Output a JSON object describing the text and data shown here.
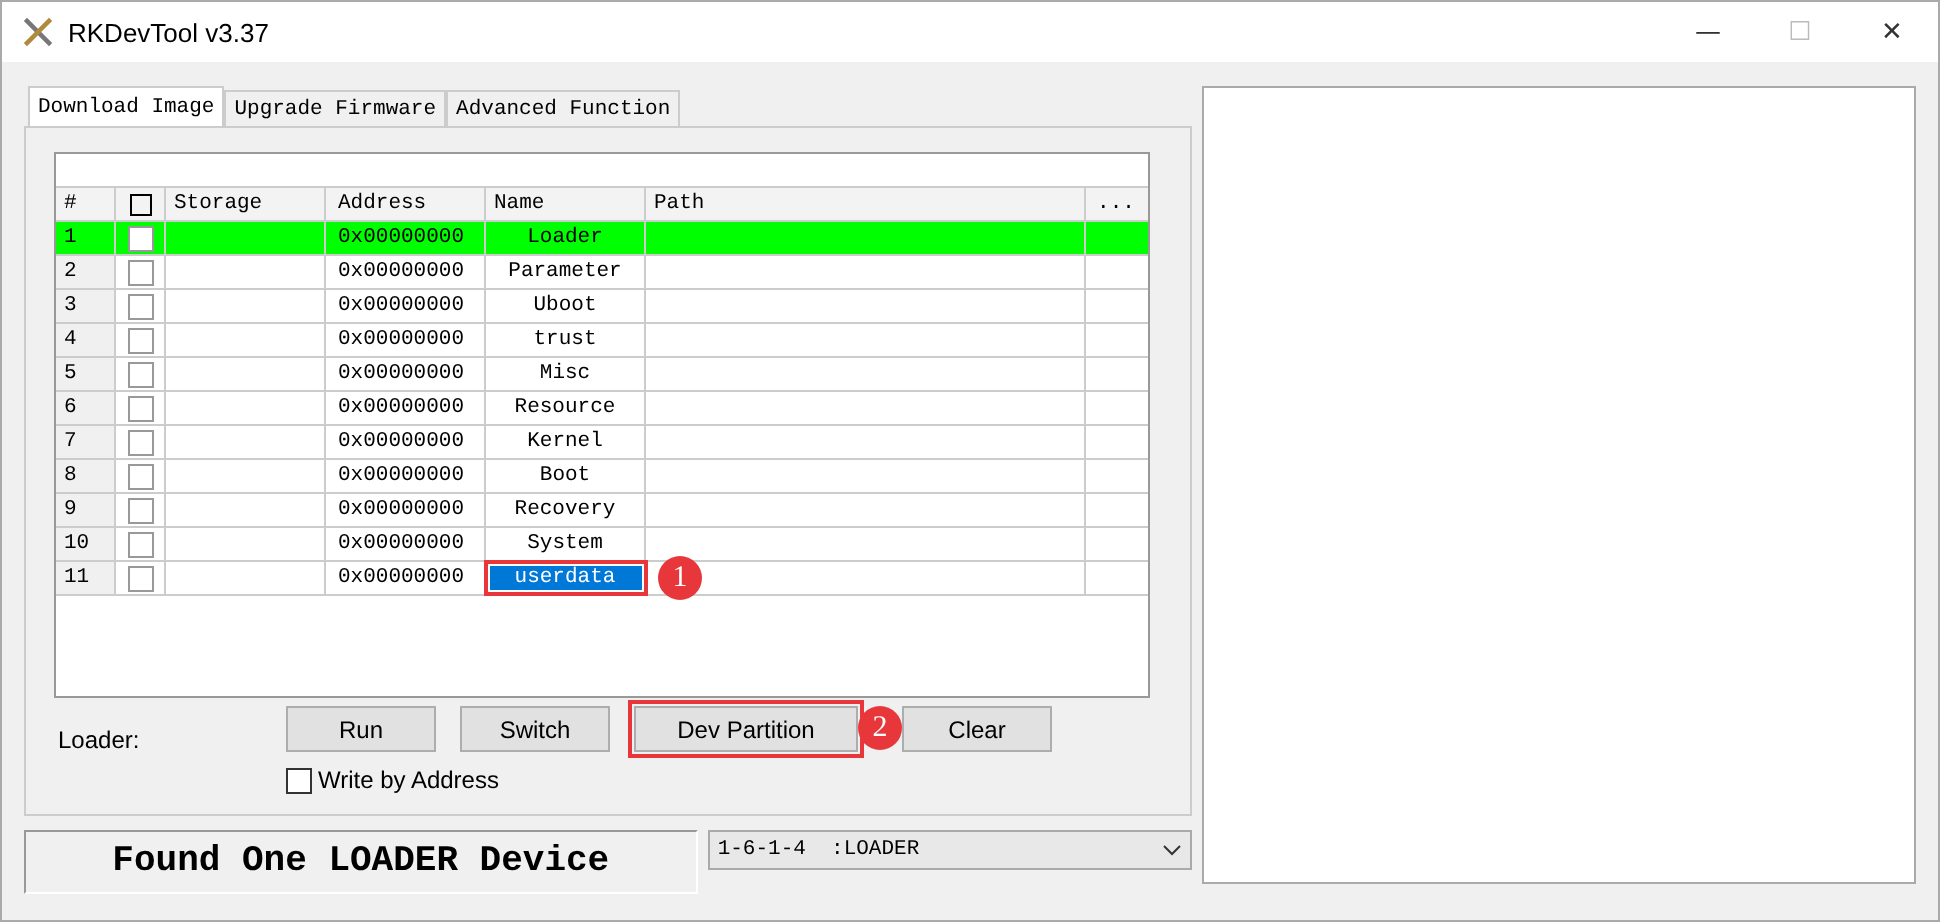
{
  "window": {
    "title": "RKDevTool v3.37",
    "controls": [
      "—",
      "☐",
      "✕"
    ]
  },
  "tabs": [
    {
      "label": "Download Image",
      "selected": true
    },
    {
      "label": "Upgrade Firmware",
      "selected": false
    },
    {
      "label": "Advanced Function",
      "selected": false
    }
  ],
  "table": {
    "all_checked": false,
    "columns": [
      "#",
      "Storage",
      "Address",
      "Name",
      "Path",
      "..."
    ],
    "rows": [
      {
        "num": "1",
        "checked": false,
        "address": "0x00000000",
        "name": "Loader",
        "selected": true,
        "name_selected": false
      },
      {
        "num": "2",
        "checked": false,
        "address": "0x00000000",
        "name": "Parameter",
        "selected": false,
        "name_selected": false
      },
      {
        "num": "3",
        "checked": false,
        "address": "0x00000000",
        "name": "Uboot",
        "selected": false,
        "name_selected": false
      },
      {
        "num": "4",
        "checked": false,
        "address": "0x00000000",
        "name": "trust",
        "selected": false,
        "name_selected": false
      },
      {
        "num": "5",
        "checked": false,
        "address": "0x00000000",
        "name": "Misc",
        "selected": false,
        "name_selected": false
      },
      {
        "num": "6",
        "checked": false,
        "address": "0x00000000",
        "name": "Resource",
        "selected": false,
        "name_selected": false
      },
      {
        "num": "7",
        "checked": false,
        "address": "0x00000000",
        "name": "Kernel",
        "selected": false,
        "name_selected": false
      },
      {
        "num": "8",
        "checked": false,
        "address": "0x00000000",
        "name": "Boot",
        "selected": false,
        "name_selected": false
      },
      {
        "num": "9",
        "checked": false,
        "address": "0x00000000",
        "name": "Recovery",
        "selected": false,
        "name_selected": false
      },
      {
        "num": "10",
        "checked": false,
        "address": "0x00000000",
        "name": "System",
        "selected": false,
        "name_selected": false
      },
      {
        "num": "11",
        "checked": false,
        "address": "0x00000000",
        "name": "userdata",
        "selected": false,
        "name_selected": true,
        "callout": "1"
      }
    ]
  },
  "loader_label": "Loader:",
  "buttons": [
    {
      "label": "Run"
    },
    {
      "label": "Switch"
    },
    {
      "label": "Dev Partition",
      "callout": "2"
    },
    {
      "label": "Clear"
    }
  ],
  "write_by_address": {
    "label": "Write by Address",
    "checked": false
  },
  "status": "Found One LOADER Device",
  "device_select": {
    "value": "1-6-1-4  :LOADER"
  }
}
